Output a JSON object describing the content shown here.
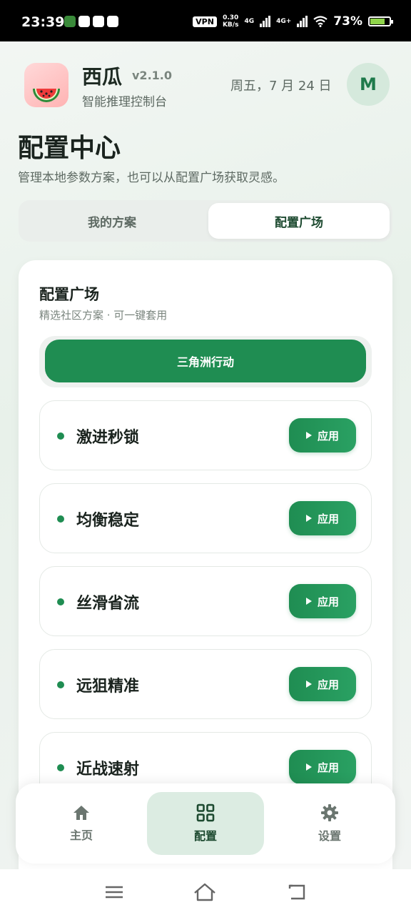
{
  "status_bar": {
    "time": "23:39",
    "vpn": "VPN",
    "speed_value": "0.30",
    "speed_unit": "KB/s",
    "net1": "4G",
    "net2": "4G+",
    "battery": "73%"
  },
  "header": {
    "app_name": "西瓜",
    "version": "v2.1.0",
    "subtitle": "智能推理控制台",
    "date": "周五，7 月 24 日",
    "avatar_initial": "M"
  },
  "page": {
    "title": "配置中心",
    "description": "管理本地参数方案，也可以从配置广场获取灵感。"
  },
  "tabs": [
    {
      "label": "我的方案",
      "selected": false
    },
    {
      "label": "配置广场",
      "selected": true
    }
  ],
  "plaza": {
    "title": "配置广场",
    "subtitle": "精选社区方案 · 可一键套用",
    "category": "三角洲行动",
    "apply_label": "应用",
    "presets": [
      {
        "name": "激进秒锁"
      },
      {
        "name": "均衡稳定"
      },
      {
        "name": "丝滑省流"
      },
      {
        "name": "远狙精准"
      },
      {
        "name": "近战速射"
      }
    ]
  },
  "nav": [
    {
      "label": "主页",
      "icon": "home-icon"
    },
    {
      "label": "配置",
      "icon": "grid-icon",
      "selected": true
    },
    {
      "label": "设置",
      "icon": "gear-icon"
    }
  ],
  "colors": {
    "accent": "#1f8d52",
    "accent_light": "#dcece2"
  }
}
